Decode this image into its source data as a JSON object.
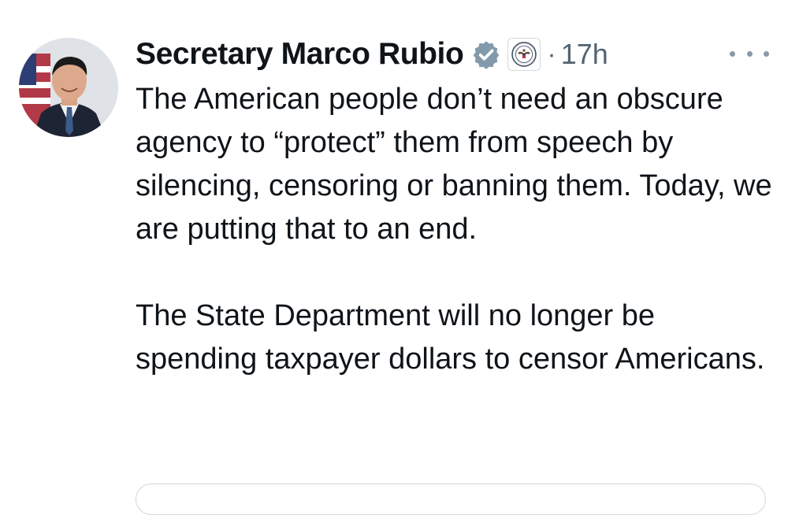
{
  "post": {
    "author_name": "Secretary Marco Rubio",
    "separator": "·",
    "timestamp": "17h",
    "paragraphs": [
      "The American people don’t need an obscure agency to “protect” them from speech by silencing, censoring or banning them. Today, we are putting that to an end.",
      "The State Department will no longer be spending taxpayer dollars to censor Americans."
    ]
  },
  "icons": {
    "verified": "verified-badge-icon",
    "affiliation": "state-department-seal-icon",
    "more": "more-options-icon"
  },
  "colors": {
    "text": "#0f1419",
    "muted": "#536471",
    "badge": "#829aab",
    "border": "#cfd9de"
  }
}
